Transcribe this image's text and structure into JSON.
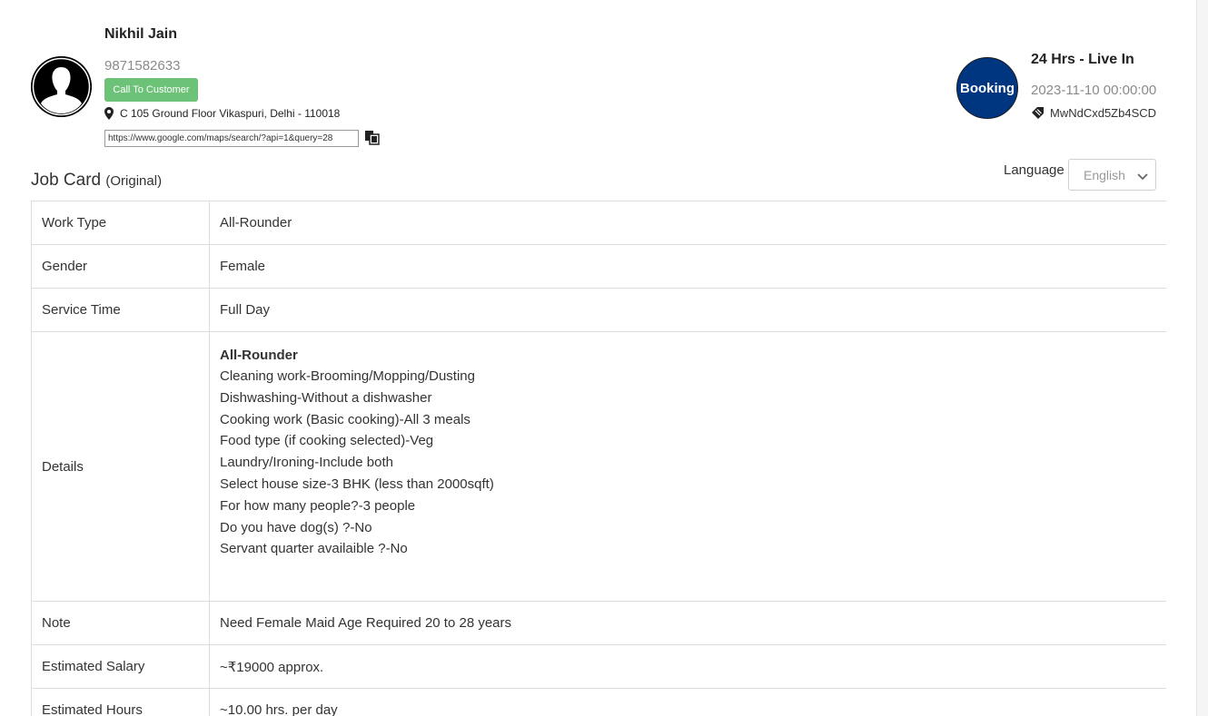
{
  "customer": {
    "name": "Nikhil Jain",
    "phone": "9871582633",
    "call_label": "Call To Customer",
    "address": "C 105 Ground Floor Vikaspuri, Delhi - 110018",
    "map_url": "https://www.google.com/maps/search/?api=1&query=28"
  },
  "booking": {
    "logo_text": "Booking",
    "service": "24 Hrs - Live In",
    "date": "2023-11-10 00:00:00",
    "code": "MwNdCxd5Zb4SCD"
  },
  "job_card": {
    "title": "Job Card",
    "subtitle": "(Original)",
    "language_label": "Language",
    "language_value": "English"
  },
  "rows": {
    "work_type": {
      "key": "Work Type",
      "value": "All-Rounder"
    },
    "gender": {
      "key": "Gender",
      "value": "Female"
    },
    "service_time": {
      "key": "Service Time",
      "value": "Full Day"
    },
    "details": {
      "key": "Details",
      "title": "All-Rounder",
      "lines": [
        "Cleaning work-Brooming/Mopping/Dusting",
        "Dishwashing-Without a dishwasher",
        "Cooking work (Basic cooking)-All 3 meals",
        "Food type (if cooking selected)-Veg",
        "Laundry/Ironing-Include both",
        "Select house size-3 BHK (less than 2000sqft)",
        "For how many people?-3 people",
        "Do you have dog(s) ?-No",
        "Servant quarter availaible ?-No"
      ]
    },
    "note": {
      "key": "Note",
      "value": "Need Female Maid Age Required 20 to 28 years"
    },
    "salary": {
      "key": "Estimated Salary",
      "value": "~₹19000 approx."
    },
    "hours": {
      "key": "Estimated Hours",
      "value": "~10.00 hrs. per day"
    }
  },
  "colors": {
    "call_button": "#6cc277",
    "booking_logo": "#003580"
  }
}
